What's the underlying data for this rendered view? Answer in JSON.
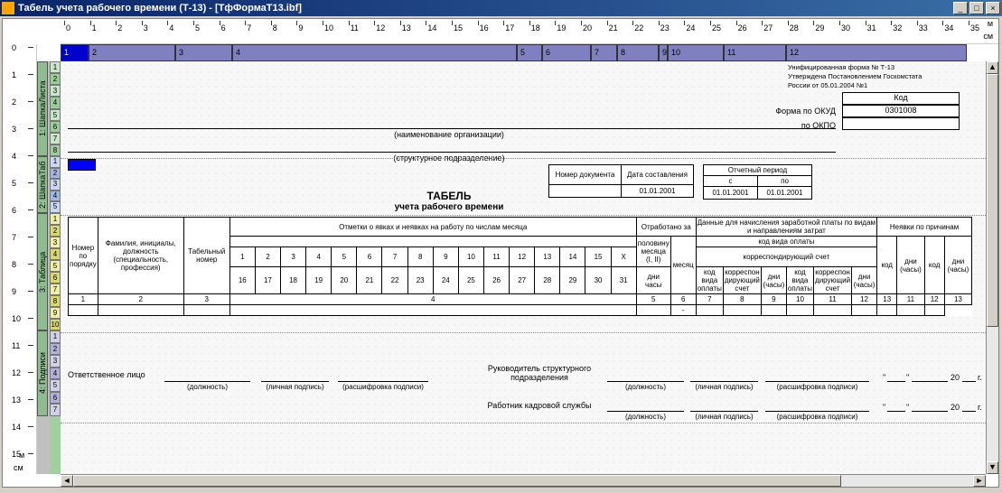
{
  "window": {
    "title": "Табель учета рабочего времени (Т-13) - [ТфФормаТ13.ibf]"
  },
  "ruler": {
    "h_unit_small": "м",
    "h_unit": "см",
    "v_unit": "см",
    "v_unit_small": "м"
  },
  "sections": {
    "s1": "1: ШапкаЛиста",
    "s2": "2: ШапкаТаб",
    "s3": "3: Таблица",
    "s4": "4: Подписи"
  },
  "col_header": [
    "1",
    "2",
    "3",
    "4",
    "5",
    "6",
    "7",
    "8",
    "9",
    "10",
    "11",
    "12"
  ],
  "form": {
    "approved1": "Унифицированная форма № Т-13",
    "approved2": "Утверждена Постановлением Госкомстата",
    "approved3": "России от 05.01.2004 №1",
    "code_hdr": "Код",
    "form_okud_lbl": "Форма по ОКУД",
    "form_okud_val": "0301008",
    "okpo_lbl": "по ОКПО",
    "org_label": "(наименование организации)",
    "struct_label": "(структурное подразделение)",
    "doc_num": "Номер документа",
    "doc_date": "Дата составления",
    "doc_date_val": "01.01.2001",
    "period_hdr": "Отчетный период",
    "period_from": "с",
    "period_to": "по",
    "period_from_val": "01.01.2001",
    "period_to_val": "01.01.2001",
    "title_main": "ТАБЕЛЬ",
    "title_sub": "учета рабочего времени"
  },
  "table": {
    "h_num": "Номер по порядку",
    "h_fio": "Фамилия, инициалы, должность (специальность, профессия)",
    "h_tabno": "Табельный номер",
    "h_marks": "Отметки о явках и неявках на работу по числам месяца",
    "h_worked": "Отработано за",
    "h_calc": "Данные для начисления заработной платы по видам и направлениям затрат",
    "h_absent": "Неявки по причинам",
    "h_paytype": "код вида оплаты",
    "h_corr": "корреспондирующий счет",
    "h_halfmonth": "половину месяца (I, II)",
    "h_month": "месяц",
    "h_days": "дни",
    "h_hours": "часы",
    "h_pay_code": "код вида оплаты",
    "h_corr_acc": "корреспон дирующий счет",
    "h_days_hours": "дни (часы)",
    "h_code": "код",
    "days1": [
      "1",
      "2",
      "3",
      "4",
      "5",
      "6",
      "7",
      "8",
      "9",
      "10",
      "11",
      "12",
      "13",
      "14",
      "15",
      "X"
    ],
    "days2": [
      "16",
      "17",
      "18",
      "19",
      "20",
      "21",
      "22",
      "23",
      "24",
      "25",
      "26",
      "27",
      "28",
      "29",
      "30",
      "31"
    ],
    "colnums": [
      "1",
      "2",
      "3",
      "4",
      "5",
      "6",
      "7",
      "8",
      "9",
      "10",
      "11",
      "12",
      "13"
    ]
  },
  "footer": {
    "responsible": "Ответственное лицо",
    "position": "(должность)",
    "signature": "(личная подпись)",
    "decipher": "(расшифровка подписи)",
    "struct_head": "Руководитель структурного подразделения",
    "hr": "Работник кадровой службы",
    "year20": "20",
    "year_end": "г.",
    "quote1": "\"",
    "quote2": "\""
  }
}
